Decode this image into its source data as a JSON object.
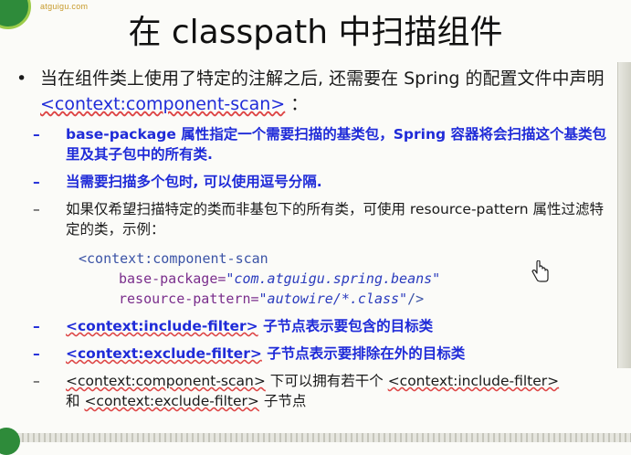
{
  "header": {
    "logo_text": "atguigu.com",
    "title": "在 classpath 中扫描组件"
  },
  "main": {
    "intro": {
      "bullet": "•",
      "text_before": "当在组件类上使用了特定的注解之后, 还需要在 Spring 的配置文件中声明",
      "tag": "<context:component-scan>",
      "text_after": "："
    },
    "items": [
      {
        "dash": "–",
        "text": "base-package 属性指定一个需要扫描的基类包，Spring 容器将会扫描这个基类包里及其子包中的所有类."
      },
      {
        "dash": "–",
        "text": "当需要扫描多个包时, 可以使用逗号分隔."
      },
      {
        "dash": "–",
        "text": "如果仅希望扫描特定的类而非基包下的所有类，可使用 resource-pattern 属性过滤特定的类，示例："
      }
    ],
    "code": {
      "line1": "<context:component-scan",
      "line2_attr": "base-package=",
      "line2_val": "\"com.atguigu.spring.beans\"",
      "line3_attr": "resource-pattern=",
      "line3_val": "\"autowire/*.class\"",
      "line3_end": "/>"
    },
    "items2": [
      {
        "dash": "–",
        "tag": "<context:include-filter>",
        "text": " 子节点表示要包含的目标类"
      },
      {
        "dash": "–",
        "tag": "<context:exclude-filter>",
        "text": " 子节点表示要排除在外的目标类"
      }
    ],
    "last": {
      "dash": "–",
      "part1": "<context:component-scan>",
      "part2": " 下可以拥有若干个 ",
      "part3": "<context:include-filter>",
      "part4": "和 ",
      "part5": "<context:exclude-filter>",
      "part6": " 子节点"
    }
  },
  "icons": {
    "cursor": "hand-pointer-icon"
  }
}
